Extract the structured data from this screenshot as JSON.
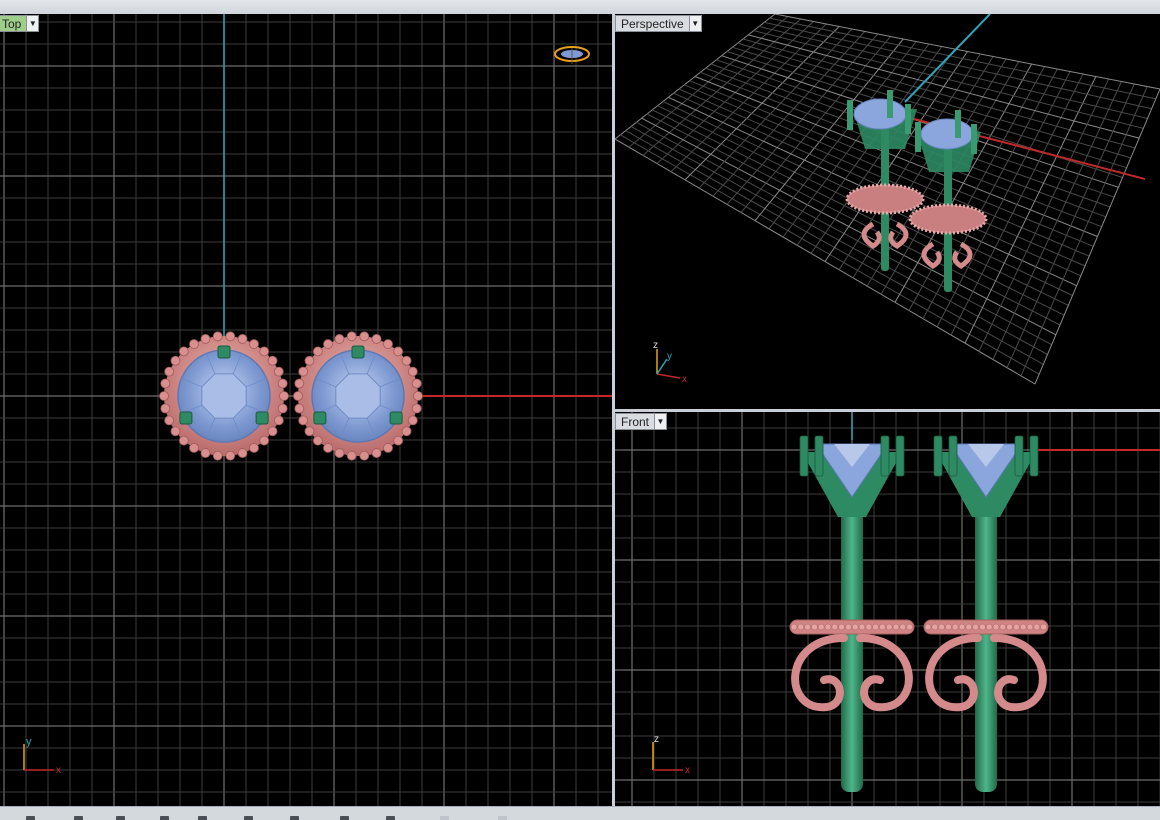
{
  "viewports": {
    "top": {
      "label": "Top"
    },
    "perspective": {
      "label": "Perspective"
    },
    "front": {
      "label": "Front"
    }
  },
  "axes": {
    "x": "x",
    "y": "y",
    "z": "z"
  },
  "dropdown_icon": "chevron-down-icon",
  "colors": {
    "viewport_bg": "#000000",
    "grid": "#5a5a5a",
    "x_axis": "#c0282a",
    "y_axis": "#2fa3b7",
    "metal_rose": "#d48a8a",
    "metal_green": "#2e8a63",
    "gem": "#8aa6dc",
    "active_tab": "#9fce8a"
  }
}
